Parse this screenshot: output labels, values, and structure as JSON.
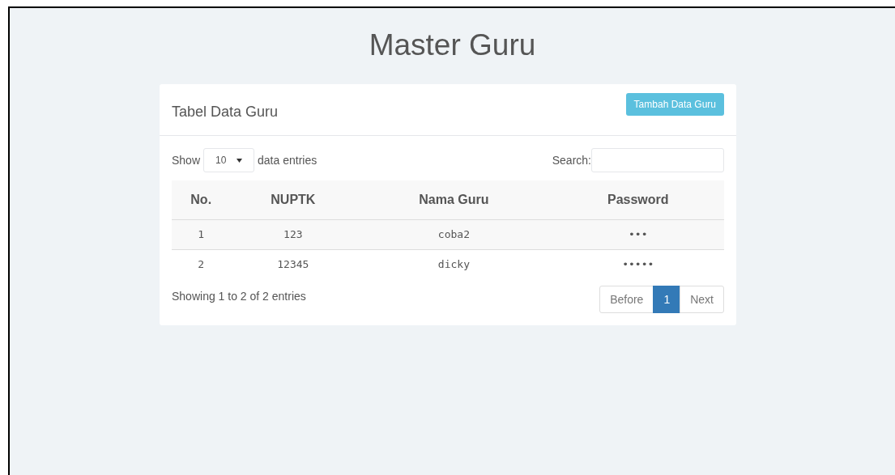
{
  "title": "Master Guru",
  "panel": {
    "title": "Tabel Data Guru",
    "add_button": "Tambah Data Guru"
  },
  "length_control": {
    "before": "Show",
    "value": "10",
    "after": "data entries"
  },
  "search": {
    "label": "Search:"
  },
  "table": {
    "columns": [
      "No.",
      "NUPTK",
      "Nama Guru",
      "Password"
    ],
    "rows": [
      [
        "1",
        "123",
        "coba2",
        "•••"
      ],
      [
        "2",
        "12345",
        "dicky",
        "•••••"
      ]
    ]
  },
  "info": "Showing 1 to 2 of 2 entries",
  "pagination": [
    {
      "label": "Before",
      "selected": false
    },
    {
      "label": "1",
      "selected": true
    },
    {
      "label": "Next",
      "selected": false
    }
  ]
}
